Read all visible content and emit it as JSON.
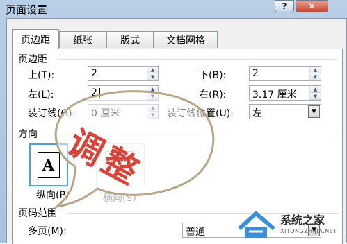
{
  "window": {
    "title": "页面设置",
    "help_label": "?",
    "close_label": "✕"
  },
  "tabs": [
    {
      "label": "页边距",
      "active": true
    },
    {
      "label": "纸张",
      "active": false
    },
    {
      "label": "版式",
      "active": false
    },
    {
      "label": "文档网格",
      "active": false
    }
  ],
  "margins": {
    "section_label": "页边距",
    "top_label": "上(T):",
    "top_value": "2",
    "bottom_label": "下(B):",
    "bottom_value": "2",
    "left_label": "左(L):",
    "left_value": "2",
    "right_label": "右(R):",
    "right_value": "3.17 厘米",
    "gutter_label": "装订线(G):",
    "gutter_value": "0 厘米",
    "gutter_pos_label": "装订线位置(U):",
    "gutter_pos_value": "左"
  },
  "orientation": {
    "section_label": "方向",
    "portrait_label": "纵向(P)",
    "landscape_label": "横向(S)",
    "icon_glyph": "A"
  },
  "pages": {
    "section_label": "页码范围",
    "multiple_label": "多页(M):",
    "multiple_value": "普通"
  },
  "overlay": {
    "balloon_text": "调整",
    "balloon_color": "#d9443a"
  },
  "watermark": {
    "name": "系统之家",
    "url": "XITONGZHIJIA.NET"
  }
}
